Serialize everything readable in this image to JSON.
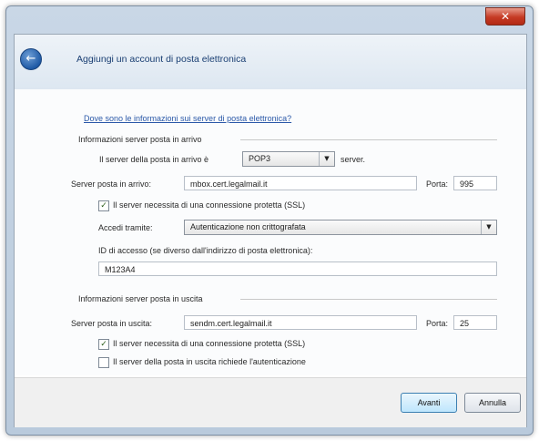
{
  "window": {
    "close_glyph": "✕"
  },
  "header": {
    "back_glyph": "←",
    "title": "Aggiungi un account di posta elettronica"
  },
  "form": {
    "help_link": "Dove sono le informazioni sui server di posta elettronica?",
    "incoming_section": "Informazioni server posta in arrivo",
    "incoming_type_label": "Il server della posta in arrivo è",
    "incoming_type_value": "POP3",
    "incoming_type_suffix": "server.",
    "incoming_server_label": "Server posta in arrivo:",
    "incoming_server_value": "mbox.cert.legalmail.it",
    "incoming_port_label": "Porta:",
    "incoming_port_value": "995",
    "ssl_in_checked": true,
    "ssl_in_label": "Il server necessita di una connessione protetta (SSL)",
    "auth_label": "Accedi tramite:",
    "auth_value": "Autenticazione non crittografata",
    "login_label": "ID di accesso (se diverso dall'indirizzo di posta elettronica):",
    "login_value": "M123A4",
    "outgoing_section": "Informazioni server posta in uscita",
    "outgoing_server_label": "Server posta in uscita:",
    "outgoing_server_value": "sendm.cert.legalmail.it",
    "outgoing_port_label": "Porta:",
    "outgoing_port_value": "25",
    "ssl_out_checked": true,
    "ssl_out_label": "Il server necessita di una connessione protetta (SSL)",
    "auth_out_checked": false,
    "auth_out_label": "Il server della posta in uscita richiede l'autenticazione",
    "check_glyph": "✓"
  },
  "footer": {
    "next_label": "Avanti",
    "cancel_label": "Annulla"
  }
}
